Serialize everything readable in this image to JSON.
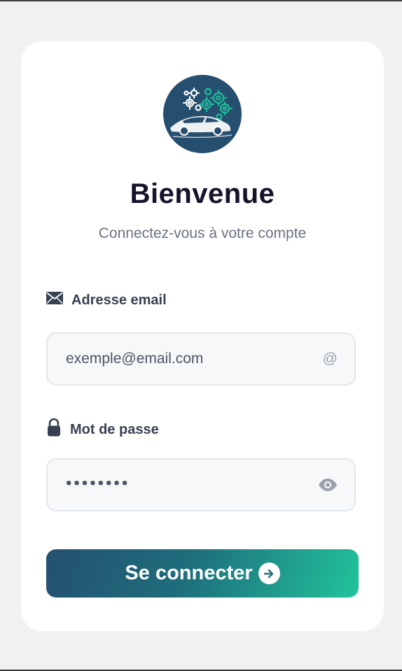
{
  "colors": {
    "brand_dark": "#264e6e",
    "brand_accent": "#21c39b"
  },
  "header": {
    "title": "Bienvenue",
    "subtitle": "Connectez-vous à votre compte",
    "logo_icon": "gears-car-logo"
  },
  "form": {
    "email": {
      "label": "Adresse email",
      "icon": "envelope-icon",
      "placeholder": "exemple@email.com",
      "trailing_symbol": "@"
    },
    "password": {
      "label": "Mot de passe",
      "icon": "lock-icon",
      "value_masked": "••••••••",
      "trailing_icon": "eye-icon"
    },
    "submit": {
      "label": "Se connecter",
      "icon": "arrow-right-circle-icon"
    }
  }
}
